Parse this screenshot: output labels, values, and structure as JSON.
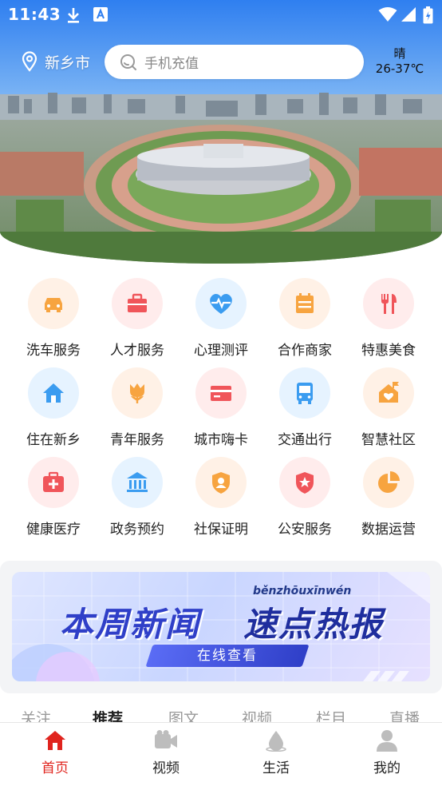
{
  "status_bar": {
    "time": "11:43"
  },
  "header": {
    "city": "新乡市",
    "search_placeholder": "手机充值",
    "weather": {
      "condition": "晴",
      "temp": "26-37℃"
    }
  },
  "services": [
    {
      "label": "洗车服务",
      "icon": "car-icon",
      "bg": "#fff1e6",
      "color": "#f7a440"
    },
    {
      "label": "人才服务",
      "icon": "briefcase-icon",
      "bg": "#ffecec",
      "color": "#f0555a"
    },
    {
      "label": "心理测评",
      "icon": "heart-pulse-icon",
      "bg": "#e6f3ff",
      "color": "#3b9cf0"
    },
    {
      "label": "合作商家",
      "icon": "store-icon",
      "bg": "#fff1e6",
      "color": "#f7a440"
    },
    {
      "label": "特惠美食",
      "icon": "cutlery-icon",
      "bg": "#ffecec",
      "color": "#f0555a"
    },
    {
      "label": "住在新乡",
      "icon": "home-icon",
      "bg": "#e6f3ff",
      "color": "#3b9cf0"
    },
    {
      "label": "青年服务",
      "icon": "tulip-icon",
      "bg": "#fff1e6",
      "color": "#f7a440"
    },
    {
      "label": "城市嗨卡",
      "icon": "card-icon",
      "bg": "#ffecec",
      "color": "#f0555a"
    },
    {
      "label": "交通出行",
      "icon": "bus-icon",
      "bg": "#e6f3ff",
      "color": "#3b9cf0"
    },
    {
      "label": "智慧社区",
      "icon": "community-icon",
      "bg": "#fff1e6",
      "color": "#f7a440"
    },
    {
      "label": "健康医疗",
      "icon": "medical-kit-icon",
      "bg": "#ffecec",
      "color": "#f0555a"
    },
    {
      "label": "政务预约",
      "icon": "government-icon",
      "bg": "#e6f3ff",
      "color": "#3b9cf0"
    },
    {
      "label": "社保证明",
      "icon": "social-security-icon",
      "bg": "#fff1e6",
      "color": "#f7a440"
    },
    {
      "label": "公安服务",
      "icon": "police-badge-icon",
      "bg": "#ffecec",
      "color": "#f0555a"
    },
    {
      "label": "数据运营",
      "icon": "pie-chart-icon",
      "bg": "#fff1e6",
      "color": "#f7a440"
    }
  ],
  "banner": {
    "pinyin": "běnzhōuxīnwén",
    "title_a": "本周新闻",
    "title_b": "速点热报",
    "button": "在线查看"
  },
  "tabs": [
    "关注",
    "推荐",
    "图文",
    "视频",
    "栏目",
    "直播"
  ],
  "active_tab": "推荐",
  "bottom_nav": [
    {
      "label": "首页",
      "icon": "home-icon",
      "active": true
    },
    {
      "label": "视频",
      "icon": "video-camera-icon",
      "active": false
    },
    {
      "label": "生活",
      "icon": "drop-icon",
      "active": false
    },
    {
      "label": "我的",
      "icon": "user-icon",
      "active": false
    }
  ],
  "colors": {
    "accent": "#e0241e",
    "inactive_nav": "#bdbdbd"
  }
}
